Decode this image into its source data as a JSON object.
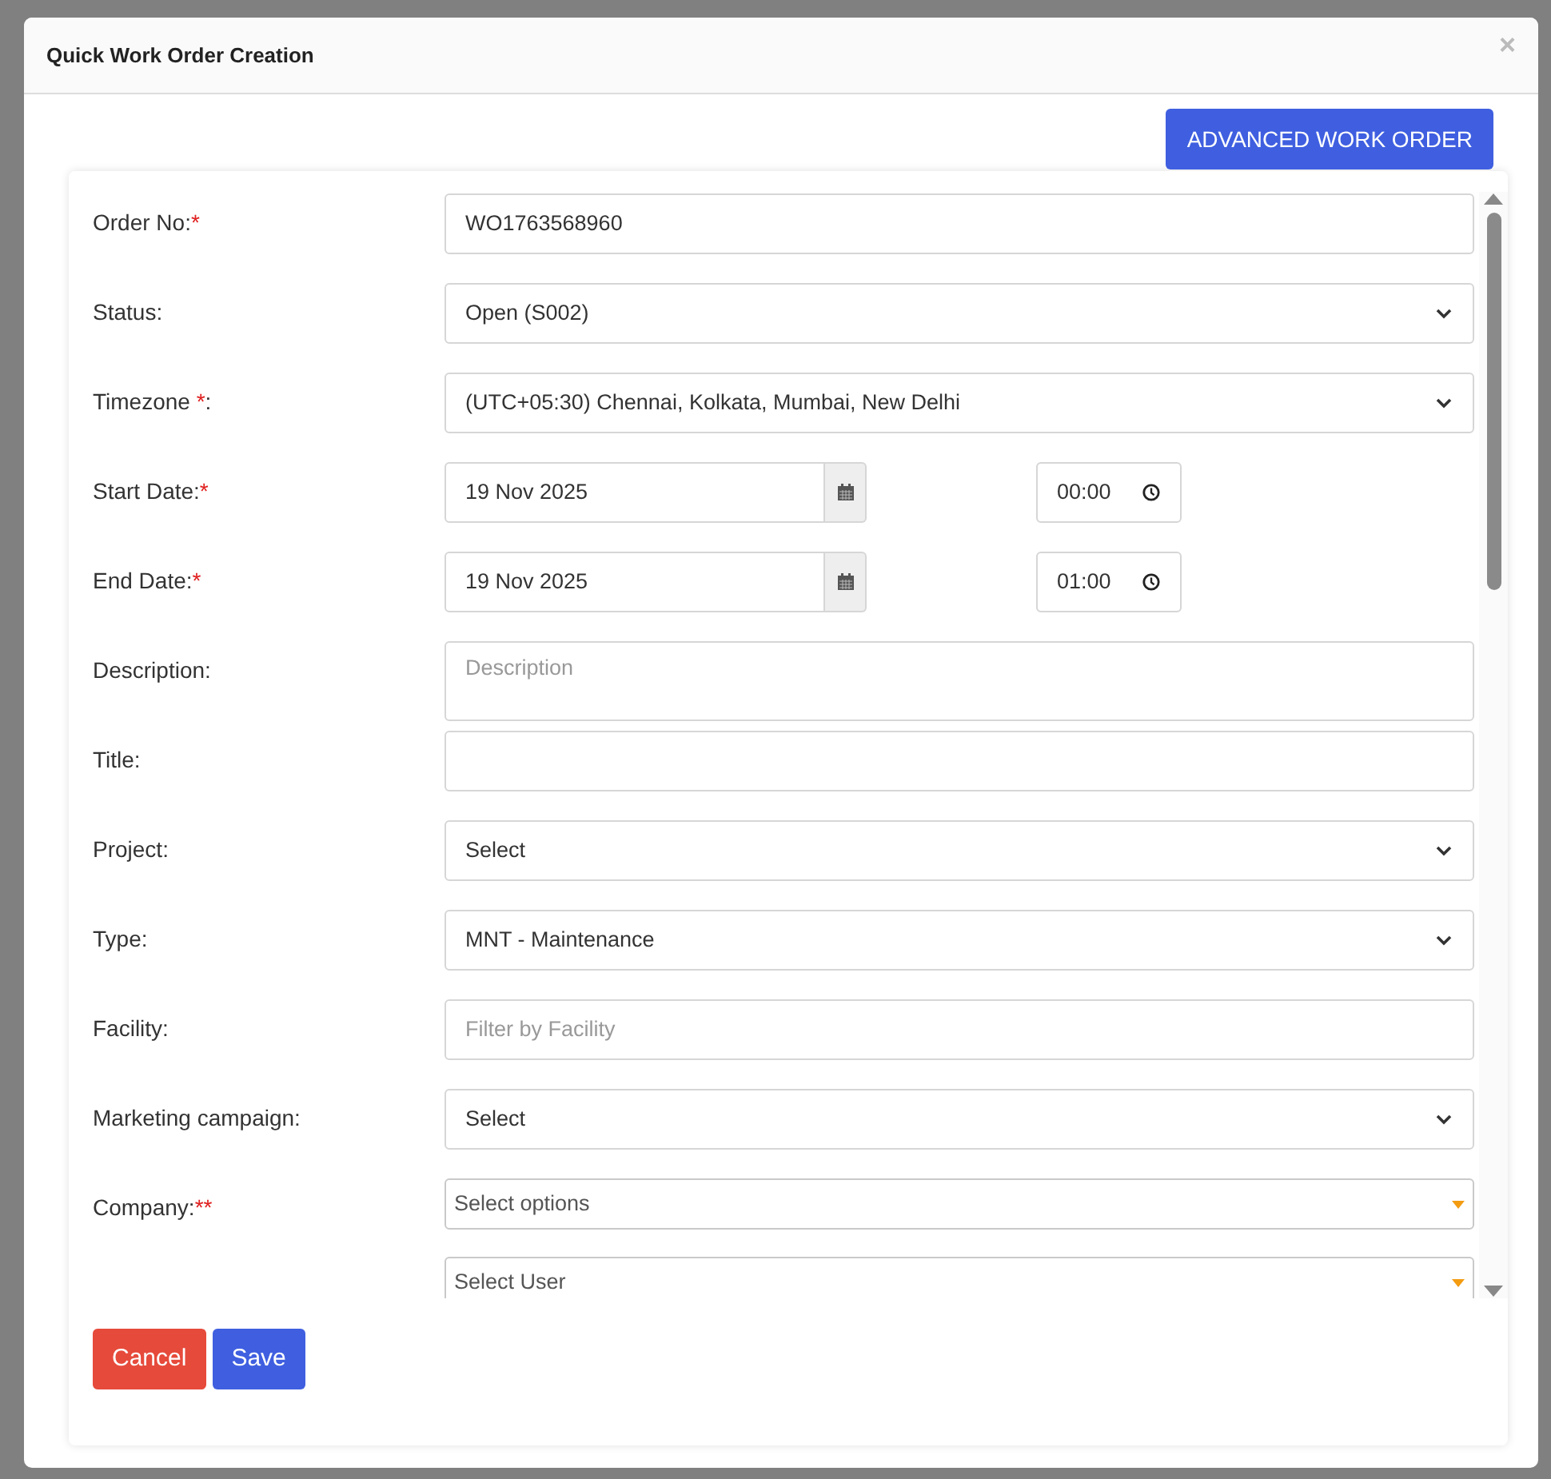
{
  "modal": {
    "title": "Quick Work Order Creation",
    "close": "×",
    "advanced_button": "ADVANCED WORK ORDER"
  },
  "fields": [
    {
      "kind": "text",
      "label": "Order No:",
      "required": "*",
      "value": "WO1763568960"
    },
    {
      "kind": "select",
      "label": "Status:",
      "value": "Open (S002)"
    },
    {
      "kind": "select",
      "label": "Timezone ",
      "required": "*",
      "suffix": ":",
      "value": "(UTC+05:30) Chennai, Kolkata, Mumbai, New Delhi"
    },
    {
      "kind": "date",
      "label": "Start Date:",
      "required": "*",
      "value": "19 Nov 2025",
      "time": "00:00"
    },
    {
      "kind": "date",
      "label": "End Date:",
      "required": "*",
      "value": "19 Nov 2025",
      "time": "01:00"
    },
    {
      "kind": "textarea",
      "label": "Description:",
      "placeholder": "Description"
    },
    {
      "kind": "text",
      "label": "Title:"
    },
    {
      "kind": "select",
      "label": "Project:",
      "value": "Select"
    },
    {
      "kind": "select",
      "label": "Type:",
      "value": "MNT - Maintenance"
    },
    {
      "kind": "text",
      "label": "Facility:",
      "placeholder": "Filter by Facility"
    },
    {
      "kind": "select",
      "label": "Marketing campaign:",
      "value": "Select"
    },
    {
      "kind": "multiselect",
      "label": "Company:",
      "required": "**",
      "placeholder": "Select options"
    },
    {
      "kind": "multiselect",
      "placeholder": "Select User"
    }
  ],
  "buttons": [
    {
      "kind": "cancel",
      "label": "Cancel"
    },
    {
      "kind": "save",
      "label": "Save"
    }
  ]
}
